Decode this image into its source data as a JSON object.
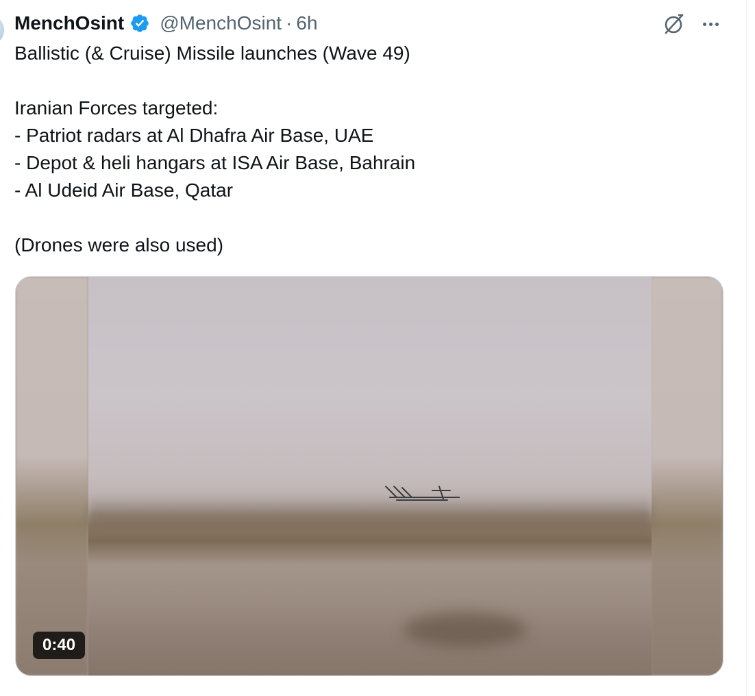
{
  "post": {
    "display_name": "MenchOsint",
    "handle": "@MenchOsint",
    "separator": "·",
    "time": "6h",
    "icons": {
      "verified": "verified-badge-icon",
      "grok": "grok-icon",
      "more": "more-options-icon"
    },
    "text_lines": [
      "Ballistic (& Cruise) Missile launches (Wave 49)",
      "",
      "Iranian Forces targeted:",
      "- Patriot radars at Al Dhafra Air Base, UAE",
      "- Depot & heli hangars at ISA Air Base, Bahrain",
      "- Al Udeid Air Base, Qatar",
      "",
      "(Drones were also used)"
    ],
    "media": {
      "type": "video",
      "duration": "0:40"
    }
  },
  "colors": {
    "verified": "#1d9bf0",
    "secondary_text": "#536471",
    "primary_text": "#0f1419"
  }
}
